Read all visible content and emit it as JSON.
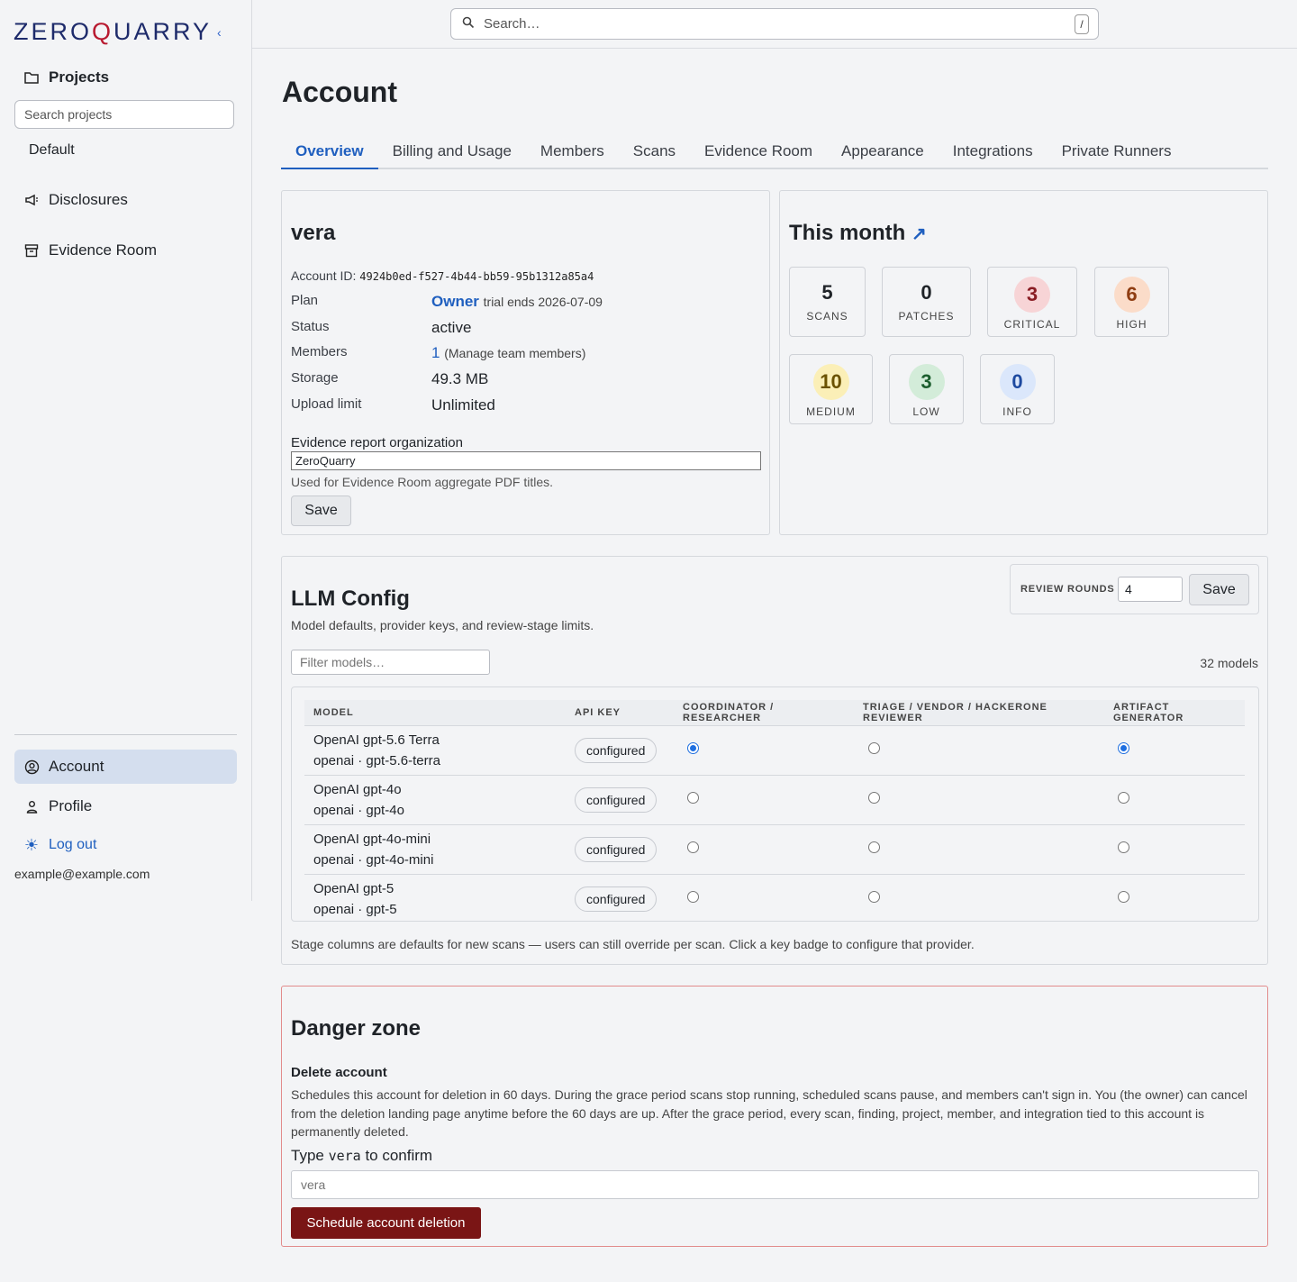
{
  "app": {
    "logo_prefix": "ZERO",
    "logo_q": "Q",
    "logo_suffix": "UARRY",
    "collapse": "‹"
  },
  "sidebar": {
    "projects_label": "Projects",
    "search_placeholder": "Search projects",
    "projects": [
      "Default"
    ],
    "disclosures_label": "Disclosures",
    "evidence_label": "Evidence Room",
    "account_label": "Account",
    "profile_label": "Profile",
    "logout_label": "Log out",
    "email": "example@example.com"
  },
  "topbar": {
    "search_placeholder": "Search…",
    "shortcut": "/"
  },
  "page": {
    "title": "Account"
  },
  "tabs": [
    "Overview",
    "Billing and Usage",
    "Members",
    "Scans",
    "Evidence Room",
    "Appearance",
    "Integrations",
    "Private Runners"
  ],
  "account": {
    "name": "vera",
    "id_label": "Account ID:",
    "id_value": "4924b0ed-f527-4b44-bb59-95b1312a85a4",
    "plan_label": "Plan",
    "plan_value": "Owner",
    "plan_note": "trial ends 2026-07-09",
    "status_label": "Status",
    "status_value": "active",
    "members_label": "Members",
    "members_value": "1",
    "members_note": "(Manage team members)",
    "storage_label": "Storage",
    "storage_value": "49.3 MB",
    "upload_label": "Upload limit",
    "upload_value": "Unlimited",
    "org_label": "Evidence report organization",
    "org_value": "ZeroQuarry",
    "org_help": "Used for Evidence Room aggregate PDF titles.",
    "save_label": "Save"
  },
  "month": {
    "title": "This month",
    "arrow": "↗",
    "stats": [
      {
        "value": "5",
        "label": "SCANS"
      },
      {
        "value": "0",
        "label": "PATCHES"
      },
      {
        "value": "3",
        "label": "CRITICAL",
        "bg": "#f7d4d6",
        "fg": "#8a1d24"
      },
      {
        "value": "6",
        "label": "HIGH",
        "bg": "#fbdcc9",
        "fg": "#8f3d12"
      },
      {
        "value": "10",
        "label": "MEDIUM",
        "bg": "#fbefb7",
        "fg": "#6b5200"
      },
      {
        "value": "3",
        "label": "LOW",
        "bg": "#d3ecd9",
        "fg": "#1c5e2e"
      },
      {
        "value": "0",
        "label": "INFO",
        "bg": "#dbe7fb",
        "fg": "#1e4aa0"
      }
    ]
  },
  "llm": {
    "title": "LLM Config",
    "subtitle": "Model defaults, provider keys, and review-stage limits.",
    "review_label": "REVIEW ROUNDS",
    "review_value": "4",
    "save_label": "Save",
    "filter_placeholder": "Filter models…",
    "model_count": "32 models",
    "columns": [
      "MODEL",
      "API KEY",
      "COORDINATOR / RESEARCHER",
      "TRIAGE / VENDOR / HACKERONE REVIEWER",
      "ARTIFACT GENERATOR"
    ],
    "models": [
      {
        "name": "OpenAI gpt-5.6 Terra",
        "id": "openai · gpt-5.6-terra",
        "key": "configured",
        "coord": true,
        "triage": false,
        "artifact": true
      },
      {
        "name": "OpenAI gpt-4o",
        "id": "openai · gpt-4o",
        "key": "configured",
        "coord": false,
        "triage": false,
        "artifact": false
      },
      {
        "name": "OpenAI gpt-4o-mini",
        "id": "openai · gpt-4o-mini",
        "key": "configured",
        "coord": false,
        "triage": false,
        "artifact": false
      },
      {
        "name": "OpenAI gpt-5",
        "id": "openai · gpt-5",
        "key": "configured",
        "coord": false,
        "triage": false,
        "artifact": false
      }
    ],
    "footnote": "Stage columns are defaults for new scans — users can still override per scan. Click a key badge to configure that provider."
  },
  "danger": {
    "title": "Danger zone",
    "delete_title": "Delete account",
    "delete_desc": "Schedules this account for deletion in 60 days. During the grace period scans stop running, scheduled scans pause, and members can't sign in. You (the owner) can cancel from the deletion landing page anytime before the 60 days are up. After the grace period, every scan, finding, project, member, and integration tied to this account is permanently deleted.",
    "confirm_prefix": "Type",
    "confirm_word": "vera",
    "confirm_suffix": "to confirm",
    "input_placeholder": "vera",
    "button_label": "Schedule account deletion",
    "color": "#7a1515"
  }
}
